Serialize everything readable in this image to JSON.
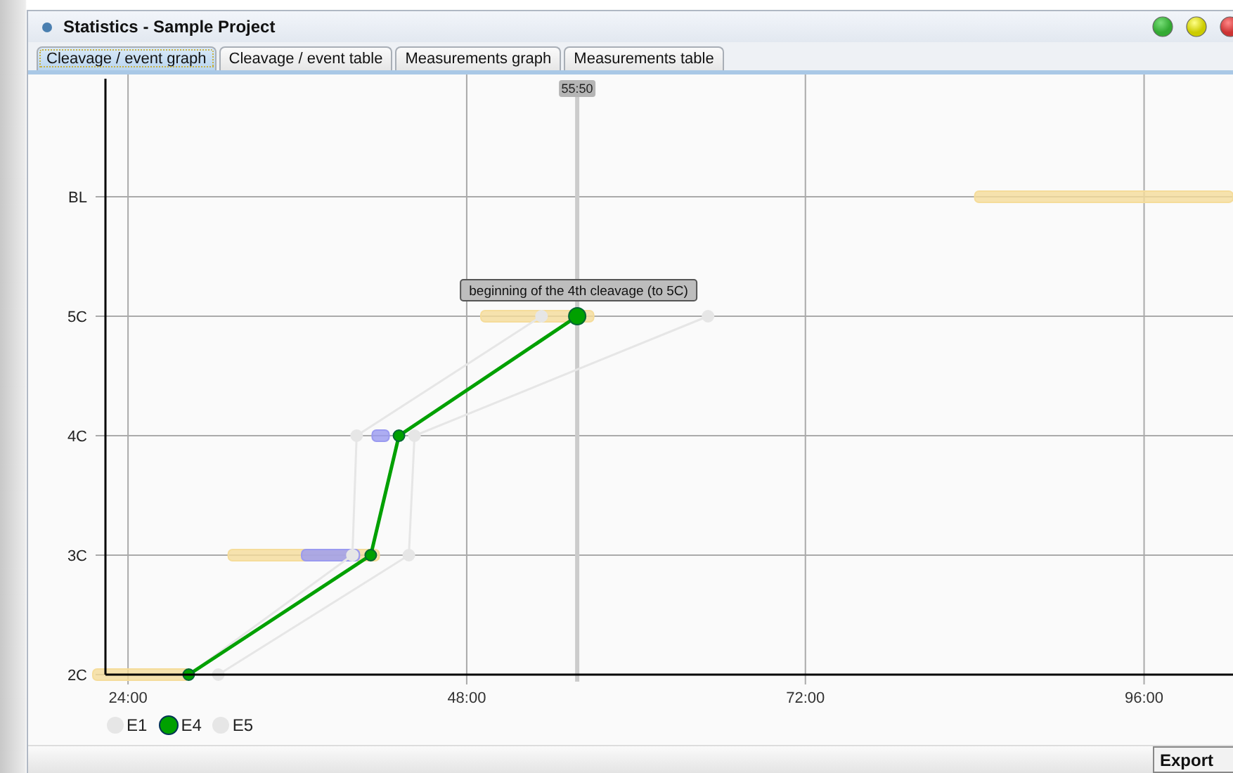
{
  "window": {
    "title": "Statistics - Sample Project"
  },
  "tabs": [
    {
      "label": "Cleavage / event graph",
      "selected": true
    },
    {
      "label": "Cleavage / event table",
      "selected": false
    },
    {
      "label": "Measurements graph",
      "selected": false
    },
    {
      "label": "Measurements table",
      "selected": false
    }
  ],
  "graph": {
    "cursor_label": "55:50",
    "y_labels": [
      "BL",
      "5C",
      "4C",
      "3C",
      "2C"
    ],
    "tooltip": "beginning of the 4th cleavage (to 5C)",
    "x_labels": [
      "24:00",
      "48:00",
      "72:00",
      "96:00"
    ],
    "legend": [
      {
        "label": "E1",
        "color": "#e6e6e6",
        "selected": false
      },
      {
        "label": "E4",
        "color": "#00a000",
        "selected": true
      },
      {
        "label": "E5",
        "color": "#e6e6e6",
        "selected": false
      }
    ]
  },
  "buttons": [
    {
      "label": "Export"
    }
  ]
}
